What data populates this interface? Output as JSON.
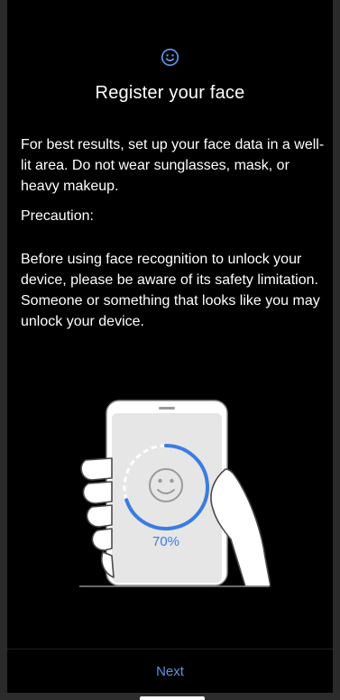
{
  "header": {
    "icon": "smiley-face-icon",
    "title": "Register your face"
  },
  "body": {
    "paragraph1": "For best results, set up your face data in a well-lit area. Do not wear sunglasses, mask, or heavy makeup.",
    "paragraph2": "Precaution:",
    "paragraph3": "Before using face recognition to unlock your device, please be aware of its safety limitation. Someone or something that looks like you may unlock your device."
  },
  "illustration": {
    "progress_fraction": 0.7,
    "progress_label": "70%",
    "accent_color": "#3b7ce0"
  },
  "footer": {
    "next_label": "Next",
    "next_color": "#5b94e6"
  },
  "colors": {
    "background": "#000000",
    "text": "#ffffff",
    "phone_screen": "#e6e6e6"
  }
}
